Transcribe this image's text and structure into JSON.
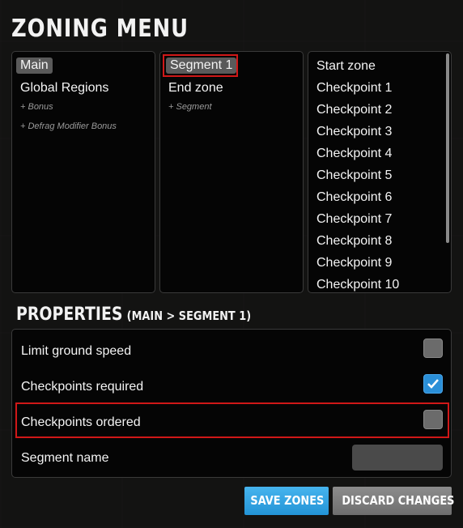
{
  "title": "ZONING MENU",
  "tracks": {
    "items": [
      {
        "label": "Main",
        "selected": true
      },
      {
        "label": "Global Regions",
        "selected": false
      }
    ],
    "add_bonus": "+ Bonus",
    "add_defrag": "+ Defrag Modifier Bonus"
  },
  "segments": {
    "items": [
      {
        "label": "Segment 1",
        "selected": true
      },
      {
        "label": "End zone",
        "selected": false
      }
    ],
    "add_segment": "+ Segment"
  },
  "zones": {
    "items": [
      "Start zone",
      "Checkpoint 1",
      "Checkpoint 2",
      "Checkpoint 3",
      "Checkpoint 4",
      "Checkpoint 5",
      "Checkpoint 6",
      "Checkpoint 7",
      "Checkpoint 8",
      "Checkpoint 9",
      "Checkpoint 10"
    ]
  },
  "properties": {
    "title": "PROPERTIES",
    "path": "(MAIN > SEGMENT 1)",
    "limit_ground_speed": {
      "label": "Limit ground speed",
      "checked": false
    },
    "checkpoints_required": {
      "label": "Checkpoints required",
      "checked": true
    },
    "checkpoints_ordered": {
      "label": "Checkpoints ordered",
      "checked": false
    },
    "segment_name": {
      "label": "Segment name",
      "value": ""
    }
  },
  "buttons": {
    "save": "SAVE ZONES",
    "discard": "DISCARD CHANGES"
  },
  "colors": {
    "accent_blue": "#2394d6",
    "highlight_red": "#d01818",
    "checkbox_grey": "#6b6b6b"
  }
}
